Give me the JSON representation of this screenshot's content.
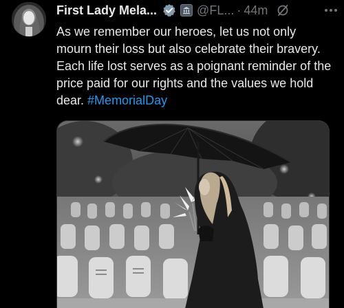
{
  "tweet": {
    "author_name": "First Lady Mela...",
    "handle": "@FL...",
    "separator": "·",
    "time": "44m",
    "text_main": "As we remember our heroes, let us not only mourn their loss but also celebrate their bravery. Each life lost serves as a poignant reminder of the price paid for our rights and the values we hold dear. ",
    "hashtag": "#MemorialDay",
    "icons": {
      "verified": "verified-badge-icon",
      "gov": "government-badge-icon",
      "grok": "grok-icon",
      "more": "more-options-icon"
    },
    "colors": {
      "background": "#000000",
      "text": "#e7e9ea",
      "secondary": "#71767b",
      "link": "#1d9bf0"
    }
  }
}
